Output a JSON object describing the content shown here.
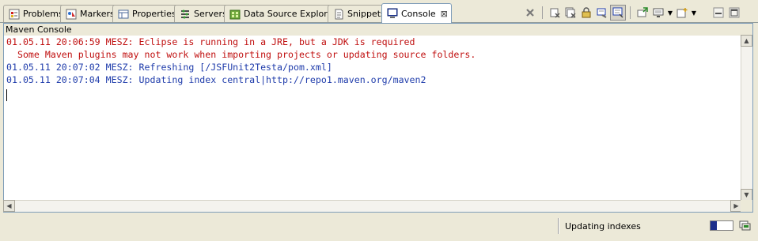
{
  "tabs": [
    {
      "label": "Problems",
      "icon": "problems-icon"
    },
    {
      "label": "Markers",
      "icon": "markers-icon"
    },
    {
      "label": "Properties",
      "icon": "properties-icon"
    },
    {
      "label": "Servers",
      "icon": "servers-icon"
    },
    {
      "label": "Data Source Explorer",
      "icon": "data-source-explorer-icon"
    },
    {
      "label": "Snippets",
      "icon": "snippets-icon"
    },
    {
      "label": "Console",
      "icon": "console-icon",
      "active": true
    }
  ],
  "panel": {
    "title": "Maven Console"
  },
  "console": {
    "lines": [
      {
        "text": "01.05.11 20:06:59 MESZ: Eclipse is running in a JRE, but a JDK is required",
        "color": "#c01010"
      },
      {
        "text": "  Some Maven plugins may not work when importing projects or updating source folders.",
        "color": "#c01010"
      },
      {
        "text": "01.05.11 20:07:02 MESZ: Refreshing [/JSFUnit2Testa/pom.xml]",
        "color": "#1f3cab"
      },
      {
        "text": "01.05.11 20:07:04 MESZ: Updating index central|http://repo1.maven.org/maven2",
        "color": "#1f3cab"
      }
    ]
  },
  "status": {
    "text": "Updating indexes",
    "progress": 0.3
  },
  "colors": {
    "accent": "#7f9db9",
    "error": "#c01010",
    "info": "#1f3cab"
  }
}
